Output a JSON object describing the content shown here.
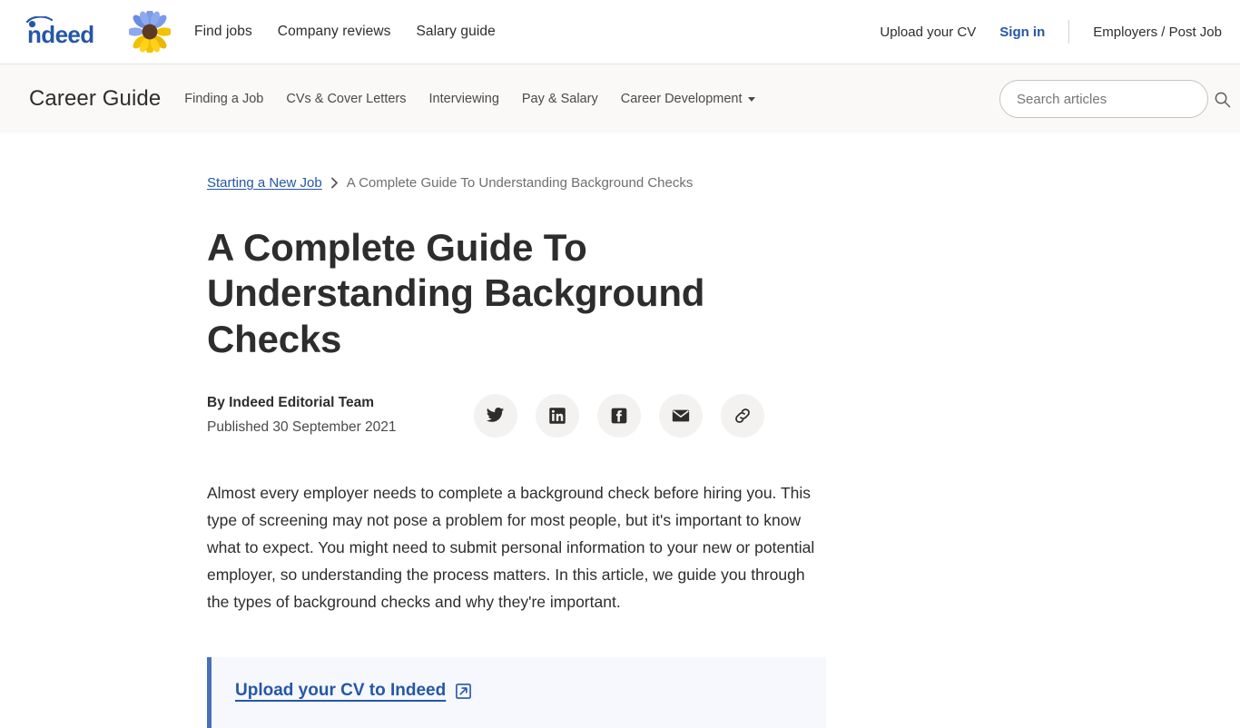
{
  "header": {
    "brand_name": "indeed",
    "nav": [
      {
        "label": "Find jobs"
      },
      {
        "label": "Company reviews"
      },
      {
        "label": "Salary guide"
      }
    ],
    "right": {
      "upload_cv": "Upload your CV",
      "sign_in": "Sign in",
      "employers": "Employers / Post Job"
    }
  },
  "guide_bar": {
    "title": "Career Guide",
    "nav": [
      {
        "label": "Finding a Job",
        "has_caret": false
      },
      {
        "label": "CVs & Cover Letters",
        "has_caret": false
      },
      {
        "label": "Interviewing",
        "has_caret": false
      },
      {
        "label": "Pay & Salary",
        "has_caret": false
      },
      {
        "label": "Career Development",
        "has_caret": true
      }
    ],
    "search_placeholder": "Search articles"
  },
  "article": {
    "breadcrumb": {
      "parent": "Starting a New Job",
      "separator": "›",
      "current": "A Complete Guide To Understanding Background Checks"
    },
    "title": "A Complete Guide To Understanding Background Checks",
    "author": "By Indeed Editorial Team",
    "published": "Published 30 September 2021",
    "share": [
      {
        "name": "twitter-share-button"
      },
      {
        "name": "linkedin-share-button"
      },
      {
        "name": "facebook-share-button"
      },
      {
        "name": "email-share-button"
      },
      {
        "name": "copy-link-button"
      }
    ],
    "lead_paragraph": "Almost every employer needs to complete a background check before hiring you. This type of screening may not pose a problem for most people, but it's important to know what to expect. You might need to submit personal information to your new or potential employer, so understanding the process matters. In this article, we guide you through the types of background checks and why they're important.",
    "callout": {
      "link_text": "Upload your CV to Indeed"
    }
  },
  "colors": {
    "indeed_blue": "#2557a7",
    "link_blue": "#2557a7",
    "callout_bar": "#4b6fb8",
    "callout_bg": "#f6f8fd",
    "guide_bar_bg": "#faf9f8",
    "share_circle": "#f3f2f1",
    "text_dark": "#2d2d2d",
    "text_muted": "#6f6f6f",
    "sunflower_petal_blue": "#6e8fe0",
    "sunflower_petal_yellow": "#f2c200",
    "sunflower_center": "#5c3a21"
  }
}
